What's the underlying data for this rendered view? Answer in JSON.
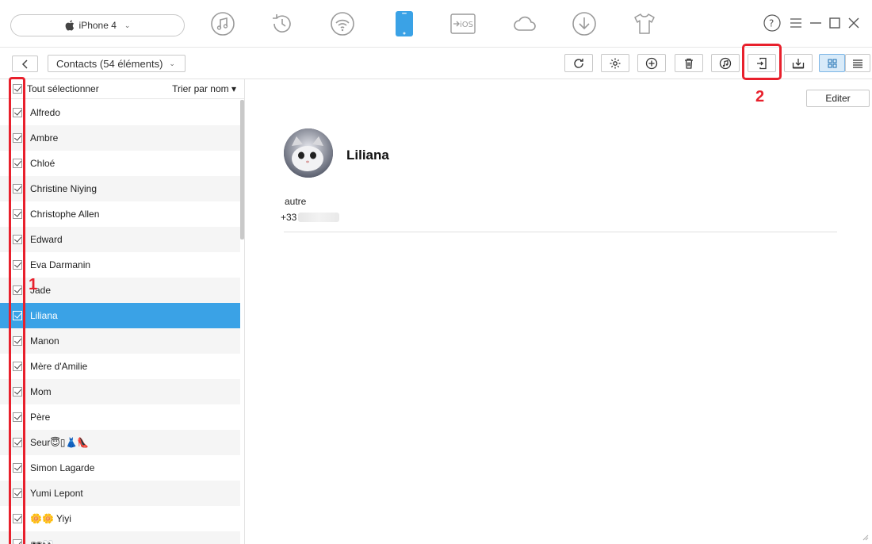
{
  "device": {
    "name": "iPhone 4"
  },
  "categories": [
    {
      "icon": "music-icon"
    },
    {
      "icon": "history-icon"
    },
    {
      "icon": "wifi-icon"
    },
    {
      "icon": "phone-manager-icon",
      "active": true
    },
    {
      "icon": "ios-mover-icon",
      "text": "iOS"
    },
    {
      "icon": "icloud-icon"
    },
    {
      "icon": "download-icon"
    },
    {
      "icon": "tshirt-icon"
    }
  ],
  "toolbar": {
    "contacts_label": "Contacts (54 éléments)"
  },
  "list": {
    "select_all_label": "Tout sélectionner",
    "sort_label": "Trier par nom ▾",
    "contacts": [
      "Alfredo",
      "Ambre",
      "Chloé",
      "Christine Niying",
      "Christophe Allen",
      "Edward",
      "Eva Darmanin",
      "Jade",
      "Liliana",
      "Manon",
      "Mère d'Amilie",
      "Mom",
      "Père",
      "Seur😇▯👗👠",
      "Simon Lagarde",
      "Yumi Lepont",
      "🌼🌼 Yiyi",
      "🕶👀"
    ],
    "selected_index": 8
  },
  "detail": {
    "edit_label": "Editer",
    "name": "Liliana",
    "phone_label": "autre",
    "phone_prefix": "+33"
  },
  "annotations": {
    "one": "1",
    "two": "2"
  },
  "colors": {
    "accent": "#3aa2e6",
    "annotation": "#e8202c",
    "active_device": "#3aa2e6"
  }
}
